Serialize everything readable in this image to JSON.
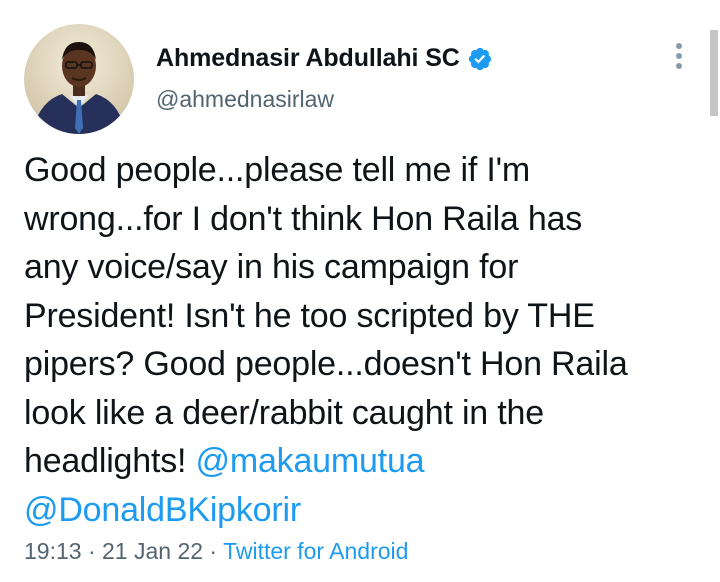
{
  "author": {
    "display_name": "Ahmednasir Abdullahi SC",
    "handle": "@ahmednasirlaw",
    "verified": true
  },
  "tweet": {
    "lines": [
      "Good people...please tell me if I'm",
      "wrong...for I don't think Hon Raila has",
      "any voice/say in his campaign for",
      "President! Isn't he too scripted by THE",
      "pipers? Good people...doesn't Hon Raila",
      "look like a deer/rabbit caught in the"
    ],
    "last_line_text": "headlights! ",
    "mentions": [
      "@makaumutua",
      "@DonaldBKipkorir"
    ]
  },
  "meta": {
    "time": "19:13",
    "separator": " · ",
    "date": "21 Jan 22",
    "source": "Twitter for Android"
  },
  "icons": {
    "verified": "verified-badge-icon",
    "more": "more-vertical-icon"
  },
  "colors": {
    "accent": "#1d9bf0",
    "text": "#0f1419",
    "secondary": "#536471"
  }
}
